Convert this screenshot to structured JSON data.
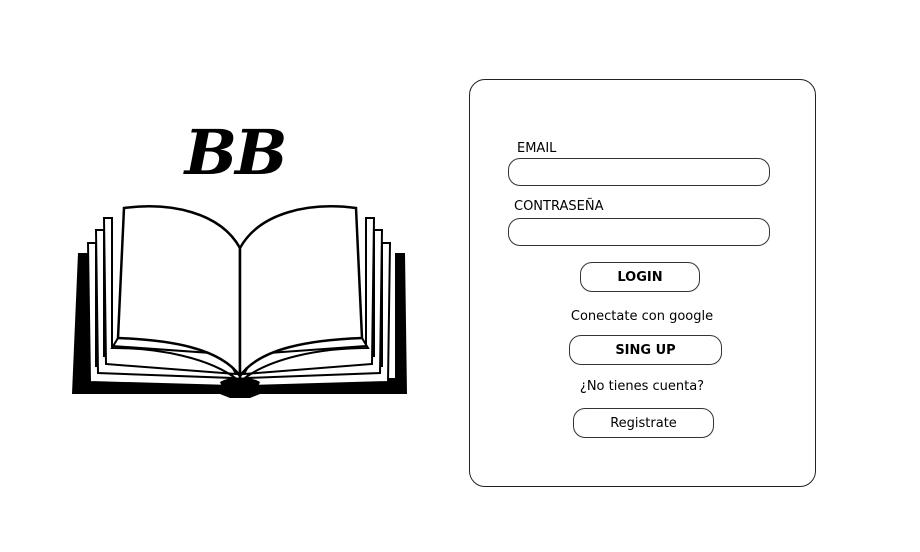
{
  "logo": {
    "text": "BB",
    "icon": "open-book-icon"
  },
  "login_form": {
    "email_label": "EMAIL",
    "email_value": "",
    "password_label": "CONTRASEÑA",
    "password_value": "",
    "login_button": "LOGIN",
    "google_text": "Conectate con google",
    "signup_button": "SING UP",
    "no_account_text": "¿No tienes cuenta?",
    "register_button": "Registrate"
  }
}
